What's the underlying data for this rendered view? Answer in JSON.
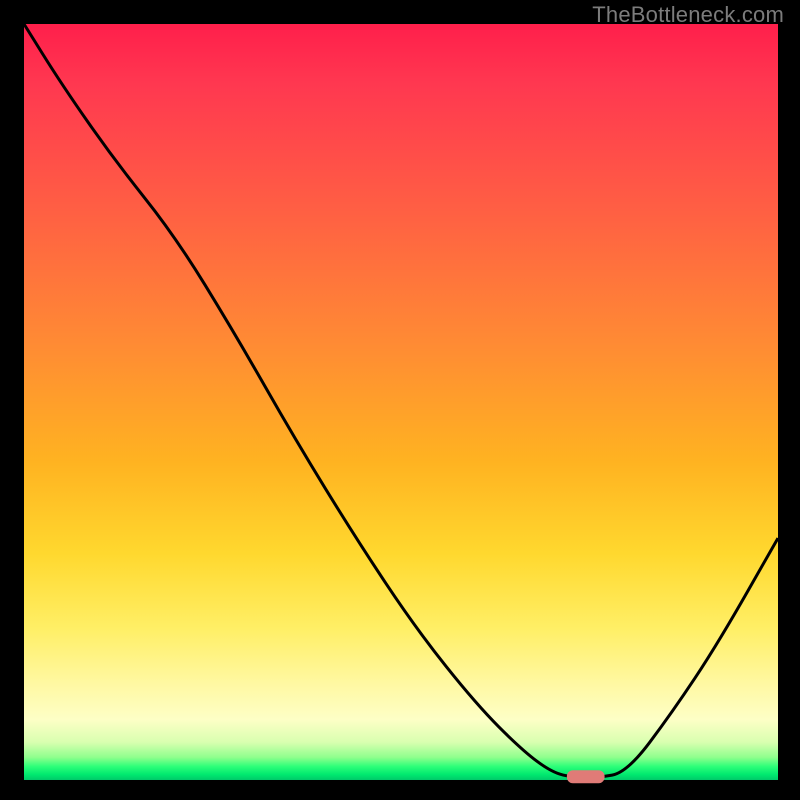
{
  "credit_text": "TheBottleneck.com",
  "chart_data": {
    "type": "line",
    "title": "",
    "xlabel": "",
    "ylabel": "",
    "xlim": [
      0,
      100
    ],
    "ylim": [
      0,
      100
    ],
    "grid": false,
    "legend": false,
    "series": [
      {
        "name": "bottleneck-curve",
        "x": [
          0,
          5,
          12,
          20,
          28,
          36,
          44,
          52,
          60,
          66,
          70,
          73,
          76,
          80,
          86,
          92,
          100
        ],
        "y": [
          100,
          92,
          82,
          72,
          59,
          45,
          32,
          20,
          10,
          4,
          1,
          0.3,
          0.3,
          1,
          9,
          18,
          32
        ]
      }
    ],
    "marker": {
      "name": "optimal-point",
      "x": 74.5,
      "y": 0.5,
      "width_pct": 5,
      "color": "#e07b77"
    },
    "gradient_stops": [
      {
        "pos": 0,
        "color": "#ff1f4b"
      },
      {
        "pos": 0.25,
        "color": "#ff6043"
      },
      {
        "pos": 0.58,
        "color": "#ffb321"
      },
      {
        "pos": 0.8,
        "color": "#ffef66"
      },
      {
        "pos": 0.95,
        "color": "#d9ffb0"
      },
      {
        "pos": 1.0,
        "color": "#00c96a"
      }
    ]
  }
}
